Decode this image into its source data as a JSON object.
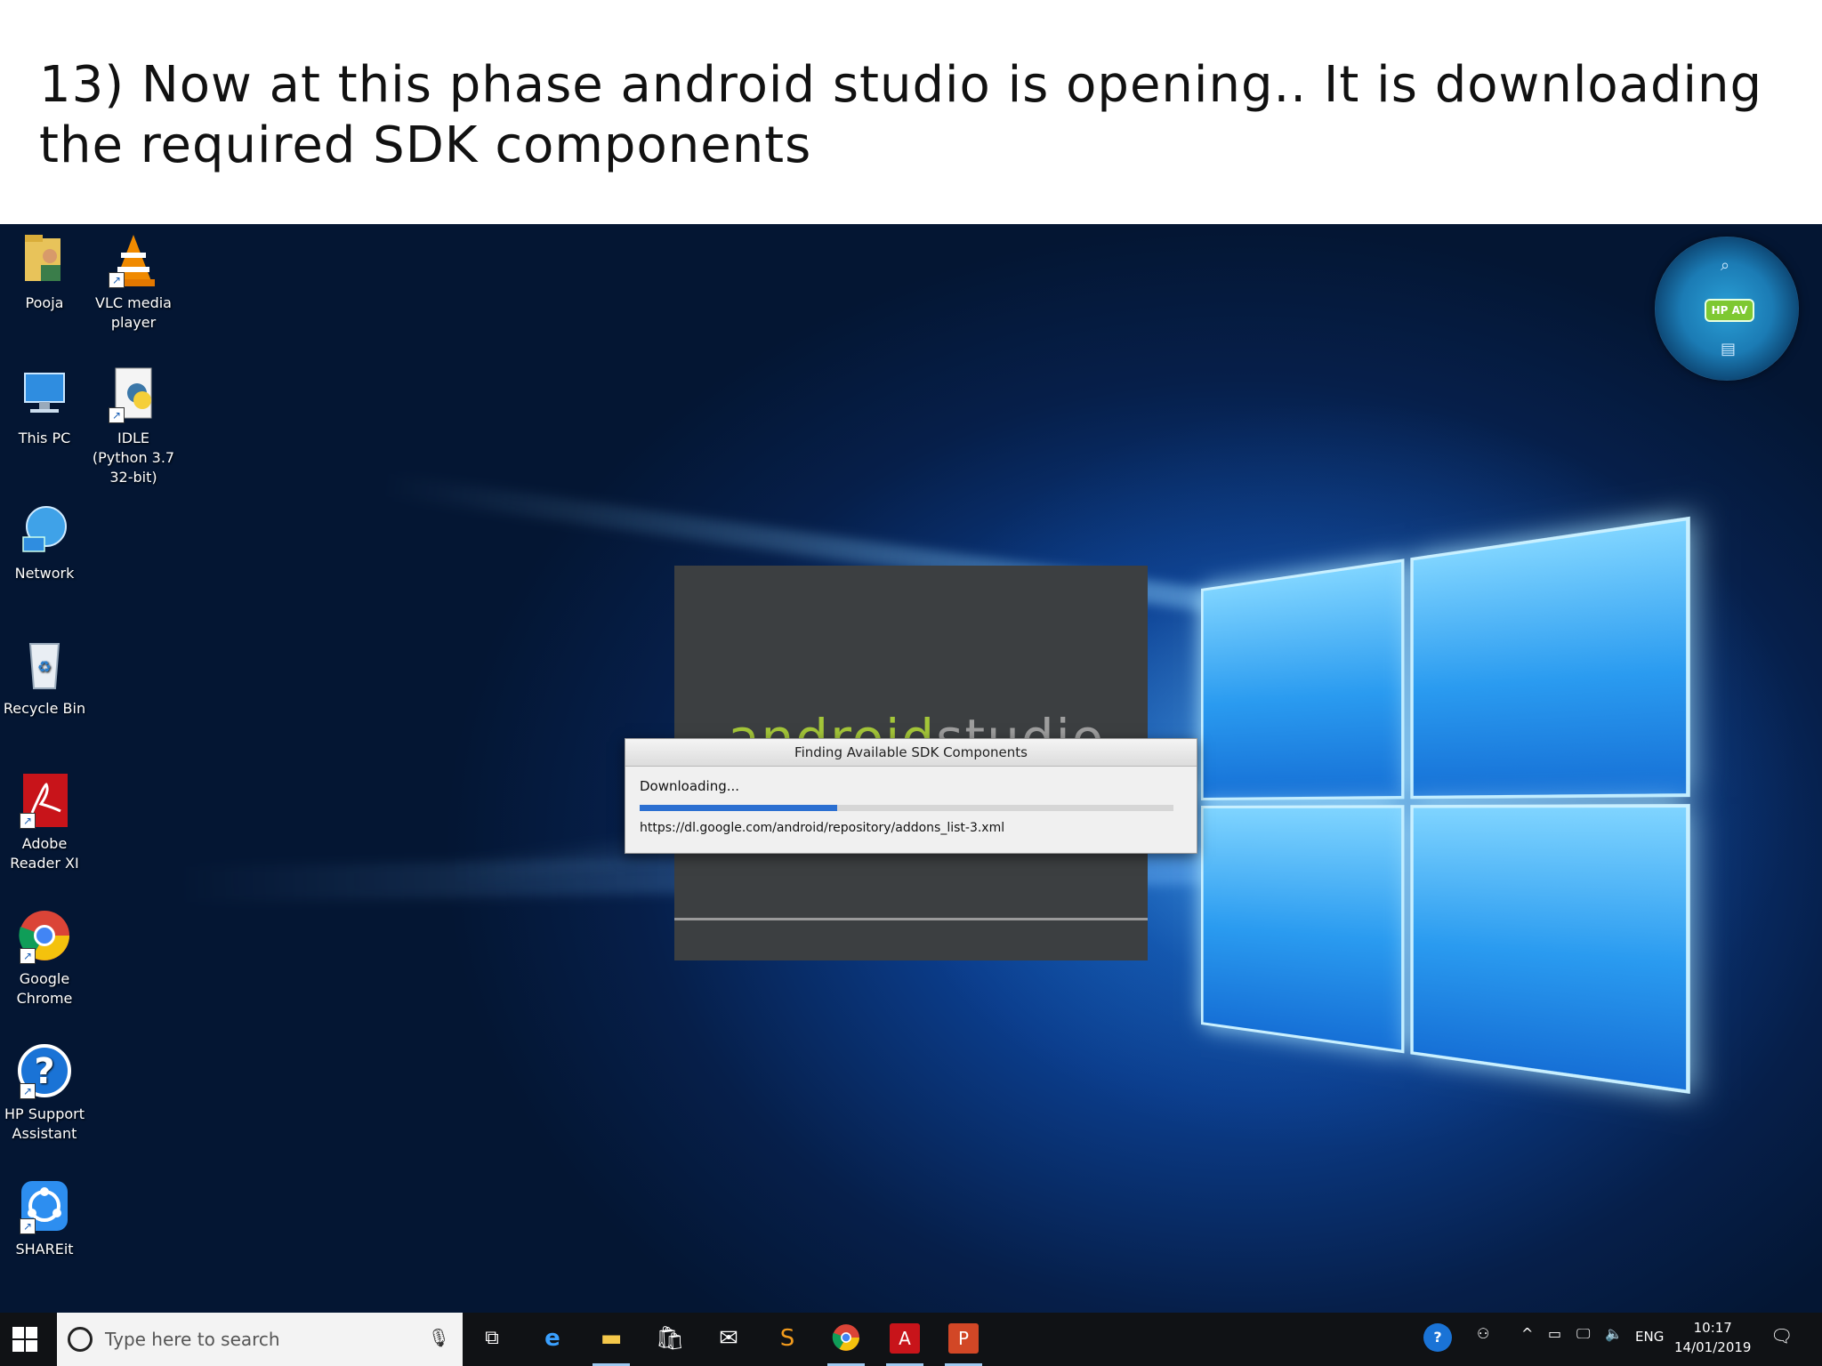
{
  "slide": {
    "title_line1": "13) Now at this phase android studio is opening.. It is downloading",
    "title_line2": "the required SDK components"
  },
  "desktop_icons": [
    {
      "label": "Pooja",
      "icon": "user-folder-icon"
    },
    {
      "label": "VLC media player",
      "icon": "vlc-cone-icon"
    },
    {
      "label": "This PC",
      "icon": "computer-icon"
    },
    {
      "label": "IDLE (Python 3.7 32-bit)",
      "icon": "python-file-icon"
    },
    {
      "label": "Network",
      "icon": "network-globe-icon"
    },
    {
      "label": "Recycle Bin",
      "icon": "recycle-bin-icon"
    },
    {
      "label": "Adobe Reader XI",
      "icon": "adobe-reader-icon"
    },
    {
      "label": "Google Chrome",
      "icon": "chrome-icon"
    },
    {
      "label": "HP Support Assistant",
      "icon": "help-icon"
    },
    {
      "label": "SHAREit",
      "icon": "shareit-icon"
    }
  ],
  "splash": {
    "logo_part1": "android",
    "logo_part2": "studio"
  },
  "dialog": {
    "title": "Finding Available SDK Components",
    "status": "Downloading...",
    "url": "https://dl.google.com/android/repository/addons_list-3.xml",
    "progress": 0.37
  },
  "gadget": {
    "label": "HP AV"
  },
  "taskbar": {
    "search_placeholder": "Type here to search",
    "language": "ENG",
    "time": "10:17",
    "date": "14/01/2019"
  },
  "colors": {
    "accent": "#2b6fd1",
    "desktop_bg": "#0b3d8c",
    "taskbar_bg": "#101215"
  }
}
